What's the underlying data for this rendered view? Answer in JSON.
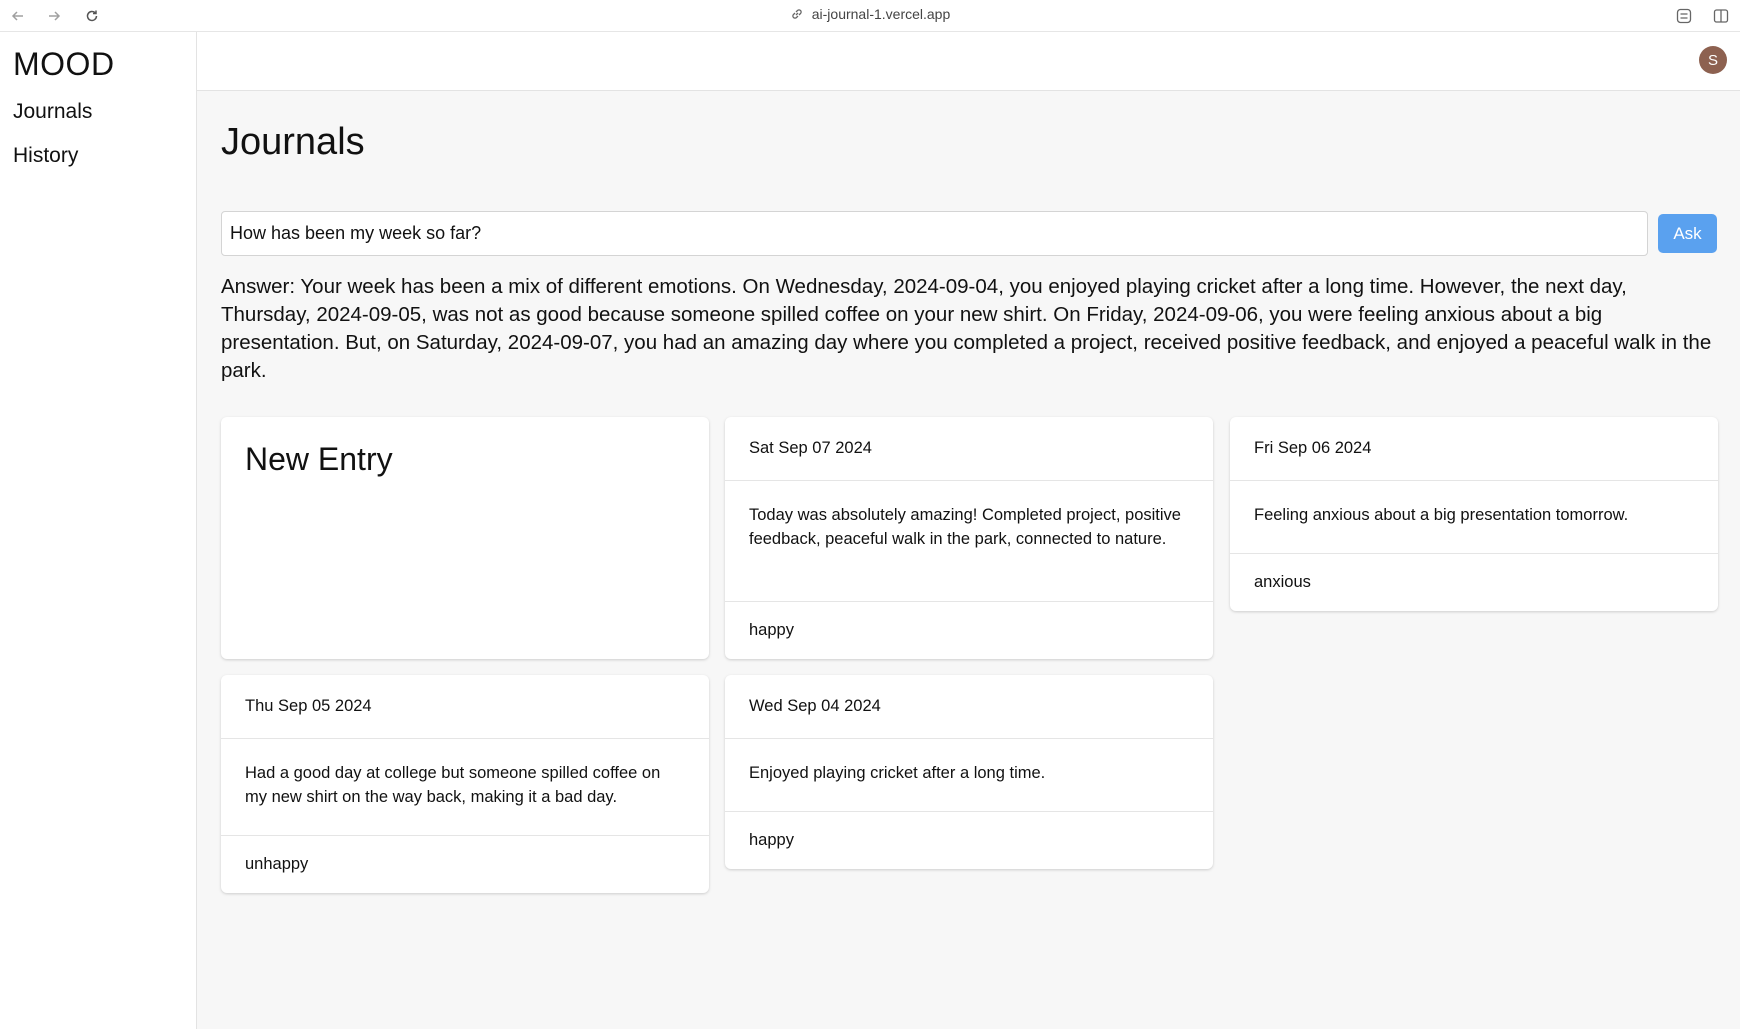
{
  "browser": {
    "url": "ai-journal-1.vercel.app",
    "back_icon": "arrow-left-icon",
    "forward_icon": "arrow-right-icon",
    "reload_icon": "reload-icon"
  },
  "sidebar": {
    "logo": "MOOD",
    "items": [
      {
        "label": "Journals"
      },
      {
        "label": "History"
      }
    ]
  },
  "header": {
    "avatar_initial": "S",
    "avatar_color": "#8d6150"
  },
  "main": {
    "title": "Journals",
    "question": {
      "value": "How has been my week so far?",
      "button_label": "Ask",
      "button_color": "#5aa1ef"
    },
    "answer": "Answer: Your week has been a mix of different emotions. On Wednesday, 2024-09-04, you enjoyed playing cricket after a long time. However, the next day, Thursday, 2024-09-05, was not as good because someone spilled coffee on your new shirt. On Friday, 2024-09-06, you were feeling anxious about a big presentation. But, on Saturday, 2024-09-07, you had an amazing day where you completed a project, received positive feedback, and enjoyed a peaceful walk in the park.",
    "new_entry_label": "New Entry",
    "entries": [
      {
        "date": "Sat Sep 07 2024",
        "summary": "Today was absolutely amazing! Completed project, positive feedback, peaceful walk in the park, connected to nature.",
        "mood": "happy"
      },
      {
        "date": "Fri Sep 06 2024",
        "summary": "Feeling anxious about a big presentation tomorrow.",
        "mood": "anxious"
      },
      {
        "date": "Thu Sep 05 2024",
        "summary": "Had a good day at college but someone spilled coffee on my new shirt on the way back, making it a bad day.",
        "mood": "unhappy"
      },
      {
        "date": "Wed Sep 04 2024",
        "summary": "Enjoyed playing cricket after a long time.",
        "mood": "happy"
      }
    ]
  }
}
